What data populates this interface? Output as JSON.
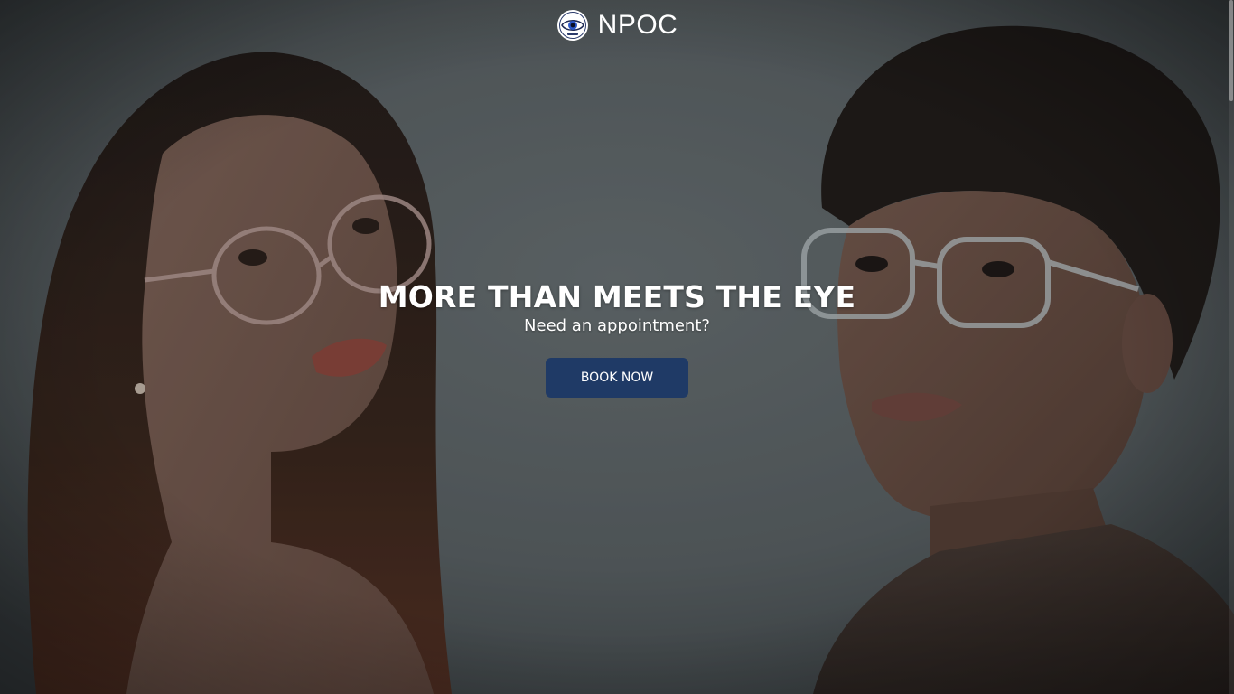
{
  "brand": {
    "name": "NPOC",
    "logo_icon": "eye-seal-logo-icon"
  },
  "hero": {
    "title": "MORE THAN MEETS THE EYE",
    "subtitle": "Need an appointment?",
    "cta_label": "BOOK NOW",
    "photo_description_icon": "hero-photo-two-people-glasses"
  },
  "colors": {
    "button_bg": "#1f3a66",
    "text": "#ffffff",
    "backdrop": "#5d6466"
  }
}
